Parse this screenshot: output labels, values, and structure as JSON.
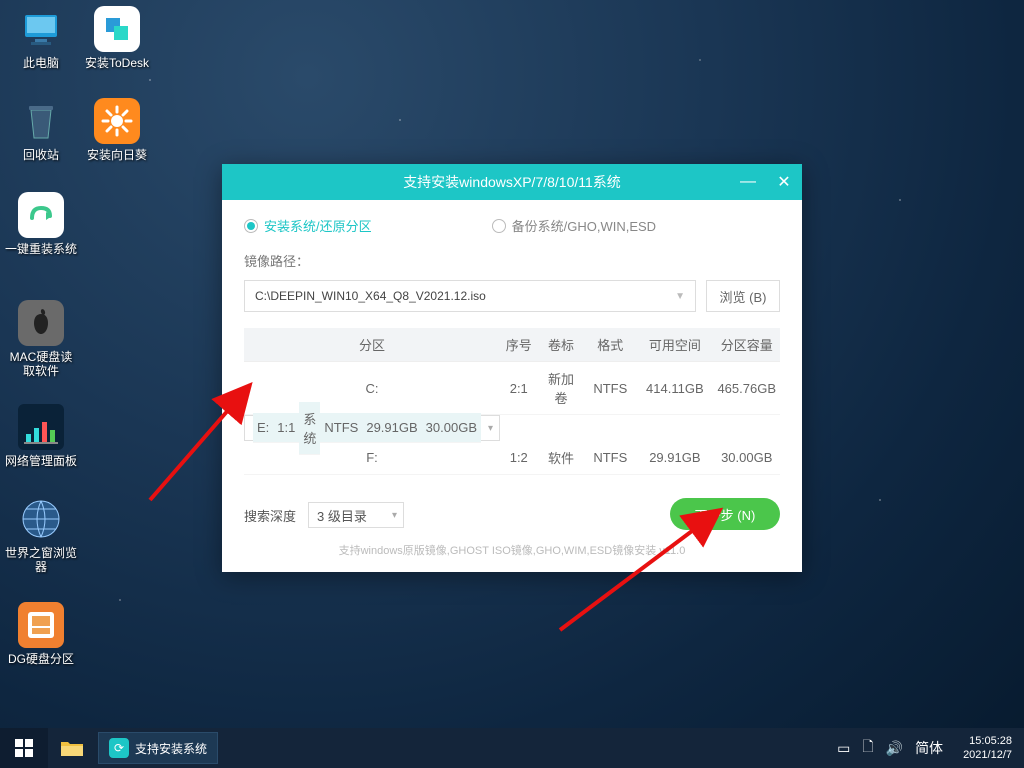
{
  "desktop_icons": {
    "this_pc": "此电脑",
    "todesk": "安装ToDesk",
    "recycle": "回收站",
    "sunflower": "安装向日葵",
    "reinstall": "一键重装系统",
    "macdisk": "MAC硬盘读取软件",
    "netpanel": "网络管理面板",
    "worldbrowser": "世界之窗浏览器",
    "dg": "DG硬盘分区"
  },
  "win": {
    "title": "支持安装windowsXP/7/8/10/11系统",
    "radio_install": "安装系统/还原分区",
    "radio_backup": "备份系统/GHO,WIN,ESD",
    "path_label": "镜像路径：",
    "path_value": "C:\\DEEPIN_WIN10_X64_Q8_V2021.12.iso",
    "browse": "浏览 (B)",
    "headers": [
      "分区",
      "序号",
      "卷标",
      "格式",
      "可用空间",
      "分区容量"
    ],
    "rows": [
      {
        "p": "C:",
        "n": "2:1",
        "v": "新加卷",
        "f": "NTFS",
        "free": "414.11GB",
        "cap": "465.76GB"
      },
      {
        "p": "E:",
        "n": "1:1",
        "v": "系统",
        "f": "NTFS",
        "free": "29.91GB",
        "cap": "30.00GB"
      },
      {
        "p": "F:",
        "n": "1:2",
        "v": "软件",
        "f": "NTFS",
        "free": "29.91GB",
        "cap": "30.00GB"
      }
    ],
    "search_label": "搜索深度",
    "search_value": "3 级目录",
    "next": "下一步 (N)",
    "support_line": "支持windows原版镜像,GHOST ISO镜像,GHO,WIM,ESD镜像安装 v11.0"
  },
  "taskbar": {
    "task_label": "支持安装系统",
    "ime": "简体",
    "time": "15:05:28",
    "date": "2021/12/7"
  }
}
